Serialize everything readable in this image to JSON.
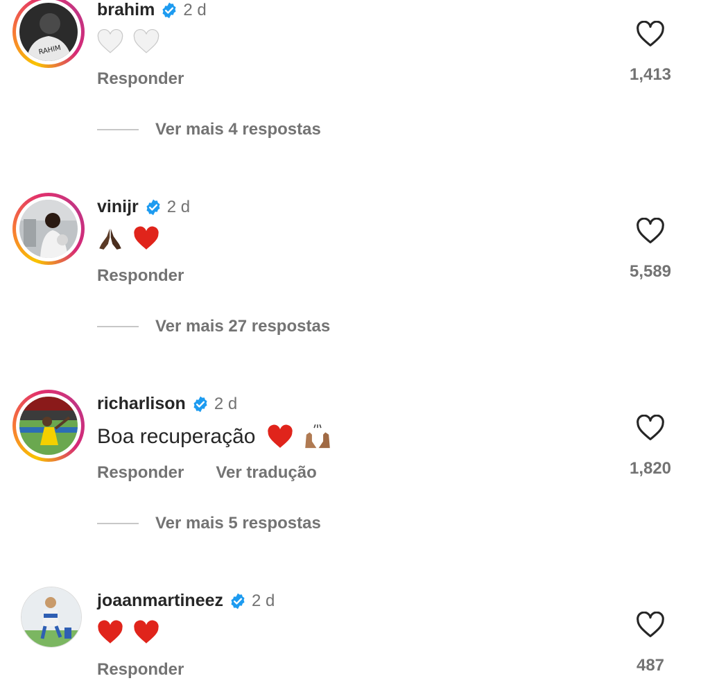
{
  "comments": [
    {
      "username": "brahim",
      "time": "2 d",
      "text": "",
      "emojis": [
        "white-heart",
        "white-heart"
      ],
      "actions": [
        "Responder"
      ],
      "likes": "1,413",
      "replies_label": "Ver mais 4 respostas"
    },
    {
      "username": "vinijr",
      "time": "2 d",
      "text": "",
      "emojis": [
        "folded-hands-dark",
        "red-heart"
      ],
      "actions": [
        "Responder"
      ],
      "likes": "5,589",
      "replies_label": "Ver mais 27 respostas"
    },
    {
      "username": "richarlison",
      "time": "2 d",
      "text": "Boa recuperação",
      "emojis": [
        "red-heart",
        "raising-hands-medium"
      ],
      "actions": [
        "Responder",
        "Ver tradução"
      ],
      "likes": "1,820",
      "replies_label": "Ver mais 5 respostas"
    },
    {
      "username": "joaanmartineez",
      "time": "2 d",
      "text": "",
      "emojis": [
        "red-heart",
        "red-heart"
      ],
      "actions": [
        "Responder"
      ],
      "likes": "487",
      "replies_label": ""
    }
  ],
  "colors": {
    "verified": "#1d9bf0",
    "muted": "#737373",
    "primary": "#262626",
    "heart_red": "#e0241b"
  }
}
